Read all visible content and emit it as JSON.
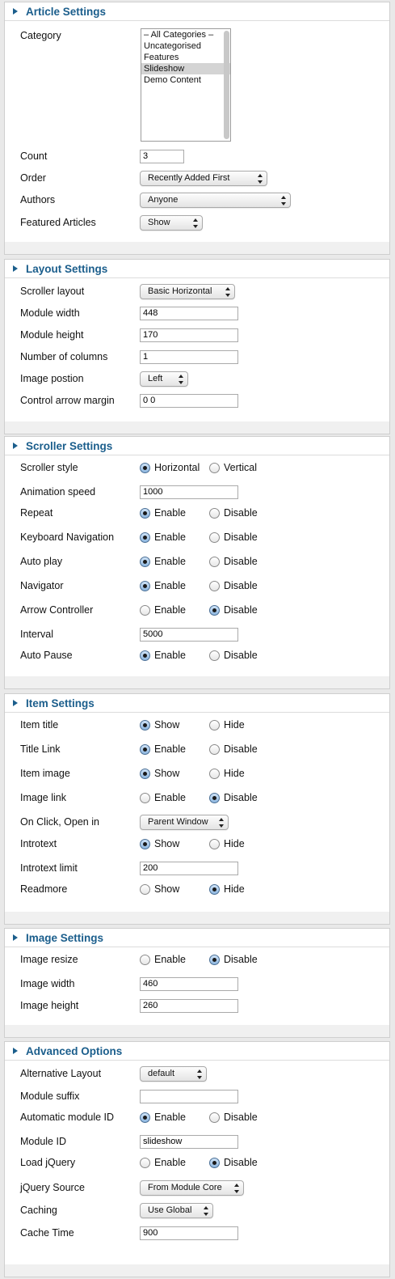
{
  "article": {
    "title": "Article Settings",
    "category_label": "Category",
    "category_options": [
      "– All Categories –",
      "Uncategorised",
      "Features",
      "Slideshow",
      "Demo Content"
    ],
    "category_selected": "Slideshow",
    "count_label": "Count",
    "count_value": "3",
    "order_label": "Order",
    "order_value": "Recently Added First",
    "authors_label": "Authors",
    "authors_value": "Anyone",
    "featured_label": "Featured Articles",
    "featured_value": "Show"
  },
  "layout": {
    "title": "Layout Settings",
    "scroller_layout_label": "Scroller layout",
    "scroller_layout_value": "Basic Horizontal",
    "module_width_label": "Module width",
    "module_width_value": "448",
    "module_height_label": "Module height",
    "module_height_value": "170",
    "columns_label": "Number of columns",
    "columns_value": "1",
    "image_position_label": "Image postion",
    "image_position_value": "Left",
    "arrow_margin_label": "Control arrow margin",
    "arrow_margin_value": "0 0"
  },
  "scroller": {
    "title": "Scroller Settings",
    "style_label": "Scroller style",
    "style_opt1": "Horizontal",
    "style_opt2": "Vertical",
    "speed_label": "Animation speed",
    "speed_value": "1000",
    "repeat_label": "Repeat",
    "keyboard_label": "Keyboard Navigation",
    "autoplay_label": "Auto play",
    "navigator_label": "Navigator",
    "arrow_label": "Arrow Controller",
    "interval_label": "Interval",
    "interval_value": "5000",
    "autopause_label": "Auto Pause",
    "enable": "Enable",
    "disable": "Disable"
  },
  "item": {
    "title": "Item Settings",
    "item_title_label": "Item title",
    "title_link_label": "Title Link",
    "item_image_label": "Item image",
    "image_link_label": "Image link",
    "onclick_label": "On Click, Open in",
    "onclick_value": "Parent Window",
    "introtext_label": "Introtext",
    "introtext_limit_label": "Introtext limit",
    "introtext_limit_value": "200",
    "readmore_label": "Readmore",
    "show": "Show",
    "hide": "Hide",
    "enable": "Enable",
    "disable": "Disable"
  },
  "image": {
    "title": "Image Settings",
    "resize_label": "Image resize",
    "width_label": "Image width",
    "width_value": "460",
    "height_label": "Image height",
    "height_value": "260",
    "enable": "Enable",
    "disable": "Disable"
  },
  "advanced": {
    "title": "Advanced Options",
    "alt_layout_label": "Alternative Layout",
    "alt_layout_value": "default",
    "suffix_label": "Module suffix",
    "suffix_value": "",
    "auto_id_label": "Automatic module ID",
    "module_id_label": "Module ID",
    "module_id_value": "slideshow",
    "jquery_label": "Load jQuery",
    "jquery_source_label": "jQuery Source",
    "jquery_source_value": "From Module Core",
    "caching_label": "Caching",
    "caching_value": "Use Global",
    "cache_time_label": "Cache Time",
    "cache_time_value": "900",
    "enable": "Enable",
    "disable": "Disable"
  },
  "colors": {
    "heading": "#1b5e8c",
    "background": "#e9e9e9",
    "footer": "#f0f0f0"
  }
}
